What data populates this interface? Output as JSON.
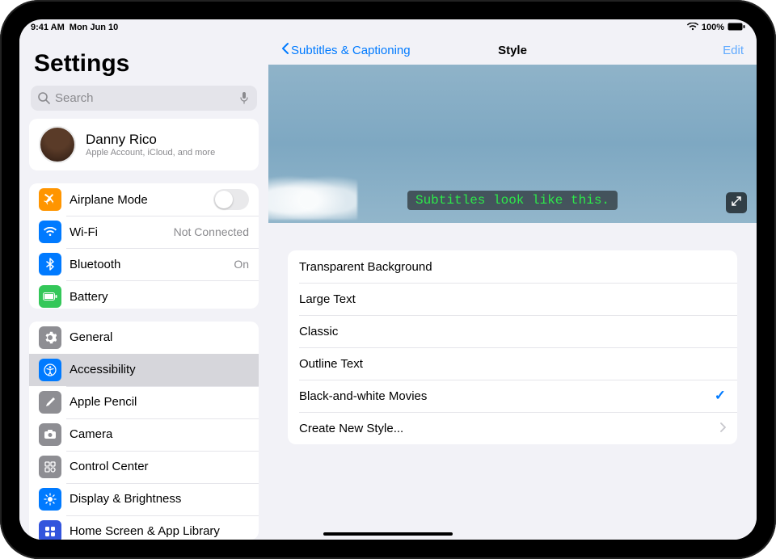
{
  "status": {
    "time": "9:41 AM",
    "date": "Mon Jun 10",
    "battery": "100%"
  },
  "sidebar": {
    "title": "Settings",
    "search_placeholder": "Search",
    "account": {
      "name": "Danny Rico",
      "sub": "Apple Account, iCloud, and more"
    },
    "group1": {
      "airplane": "Airplane Mode",
      "wifi": "Wi-Fi",
      "wifi_status": "Not Connected",
      "bluetooth": "Bluetooth",
      "bluetooth_status": "On",
      "battery": "Battery"
    },
    "group2": {
      "general": "General",
      "accessibility": "Accessibility",
      "pencil": "Apple Pencil",
      "camera": "Camera",
      "control_center": "Control Center",
      "display": "Display & Brightness",
      "home": "Home Screen & App Library"
    }
  },
  "detail": {
    "back_label": "Subtitles & Captioning",
    "title": "Style",
    "edit": "Edit",
    "subtitle_sample": "Subtitles look like this.",
    "styles": [
      "Transparent Background",
      "Large Text",
      "Classic",
      "Outline Text",
      "Black-and-white Movies"
    ],
    "create_new": "Create New Style...",
    "selected_index": 4
  }
}
